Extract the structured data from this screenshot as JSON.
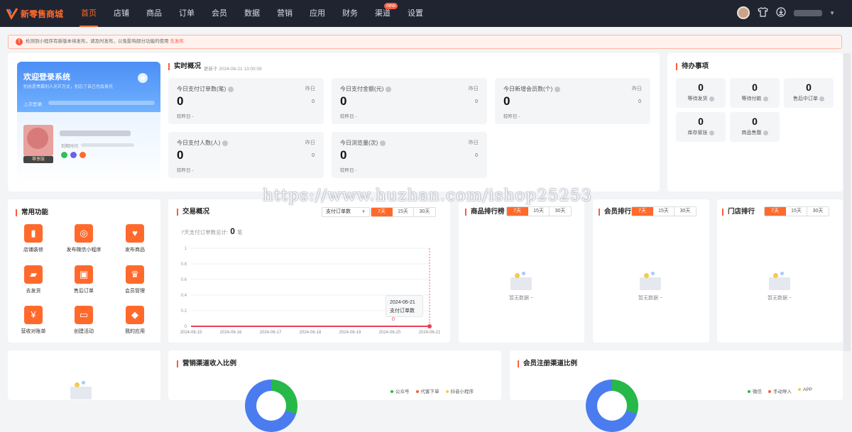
{
  "header": {
    "logo_text": "新零售商城",
    "nav": [
      {
        "label": "首页",
        "active": true
      },
      {
        "label": "店铺"
      },
      {
        "label": "商品"
      },
      {
        "label": "订单"
      },
      {
        "label": "会员"
      },
      {
        "label": "数据"
      },
      {
        "label": "营销"
      },
      {
        "label": "应用"
      },
      {
        "label": "财务"
      },
      {
        "label": "渠道",
        "badge": "new"
      },
      {
        "label": "设置"
      }
    ],
    "icons": [
      "avatar",
      "shirt-icon",
      "download-icon",
      "chevron-down-icon"
    ]
  },
  "notice": {
    "text": "检测到小程序有新版本待发布，请及时发布，以免影响部分功能的使用",
    "link": "去发布"
  },
  "welcome": {
    "title": "欢迎登录系统",
    "subtitle": "别总是羡慕别人光芒万丈，别忘了自己也会发光",
    "last_login_label": "上次登录:",
    "vip_label": "尊享版",
    "period_label": "到期时间"
  },
  "realtime": {
    "title": "实时概况",
    "updated": "更新于 2024-06-21 13:00:09",
    "yesterday_label": "昨日",
    "compare_label": "较昨日 -",
    "stats": [
      {
        "label": "今日支付订单数(笔)",
        "value": "0",
        "yesterday": "0"
      },
      {
        "label": "今日支付金额(元)",
        "value": "0",
        "yesterday": "0"
      },
      {
        "label": "今日新增会员数(个)",
        "value": "0",
        "yesterday": "0"
      },
      {
        "label": "今日支付人数(人)",
        "value": "0",
        "yesterday": "0"
      },
      {
        "label": "今日浏览量(次)",
        "value": "0",
        "yesterday": "0"
      }
    ]
  },
  "todo": {
    "title": "待办事项",
    "items": [
      {
        "label": "等待发货",
        "value": "0"
      },
      {
        "label": "等待付款",
        "value": "0"
      },
      {
        "label": "售后中订单",
        "value": "0"
      },
      {
        "label": "库存紧张",
        "value": "0"
      },
      {
        "label": "商品售罄",
        "value": "0"
      }
    ]
  },
  "functions": {
    "title": "常用功能",
    "items": [
      {
        "label": "店铺装修",
        "icon": "paint-roller-icon"
      },
      {
        "label": "发布微信小程序",
        "icon": "miniprogram-icon"
      },
      {
        "label": "发布商品",
        "icon": "gift-icon"
      },
      {
        "label": "去发货",
        "icon": "truck-icon"
      },
      {
        "label": "售后订单",
        "icon": "aftersale-icon"
      },
      {
        "label": "会员管理",
        "icon": "crown-icon"
      },
      {
        "label": "营收对账单",
        "icon": "yuan-icon"
      },
      {
        "label": "创建活动",
        "icon": "ticket-icon"
      },
      {
        "label": "我的应用",
        "icon": "cube-icon"
      }
    ]
  },
  "trade": {
    "title": "交易概况",
    "select": "支付订单数",
    "periods": [
      "7天",
      "15天",
      "30天"
    ],
    "total_label": "7天支付订单数总计:",
    "total_value": "0",
    "total_unit": "笔",
    "tooltip_date": "2024-06-21",
    "tooltip_label": "支付订单数",
    "tooltip_value": "0"
  },
  "chart_data": {
    "type": "line",
    "x": [
      "2024-06-15",
      "2024-06-16",
      "2024-06-17",
      "2024-06-18",
      "2024-06-19",
      "2024-06-20",
      "2024-06-21"
    ],
    "series": [
      {
        "name": "支付订单数",
        "values": [
          0,
          0,
          0,
          0,
          0,
          0,
          0
        ]
      }
    ],
    "yticks": [
      "0",
      "0.2",
      "0.4",
      "0.6",
      "0.8",
      "1"
    ],
    "ylim": [
      0,
      1
    ],
    "color": "#e8405a"
  },
  "rankings": [
    {
      "title": "商品排行榜",
      "periods": [
        "7天",
        "15天",
        "30天"
      ],
      "empty": "暂无数据 ~"
    },
    {
      "title": "会员排行",
      "periods": [
        "7天",
        "15天",
        "30天"
      ],
      "empty": "暂无数据 ~"
    },
    {
      "title": "门店排行",
      "periods": [
        "7天",
        "15天",
        "30天"
      ],
      "empty": "暂无数据 ~"
    }
  ],
  "bottom": {
    "marketing_title": "营销渠道收入比例",
    "marketing_legend": [
      "公众号",
      "代客下单",
      "抖音小程序"
    ],
    "member_title": "会员注册渠道比例",
    "member_legend": [
      "微信",
      "手动导入",
      "APP"
    ]
  },
  "watermark": "https://www.huzhan.com/ishop25253",
  "colors": {
    "accent": "#ff6a2c",
    "topbar": "#1f2430",
    "line": "#e8405a"
  }
}
